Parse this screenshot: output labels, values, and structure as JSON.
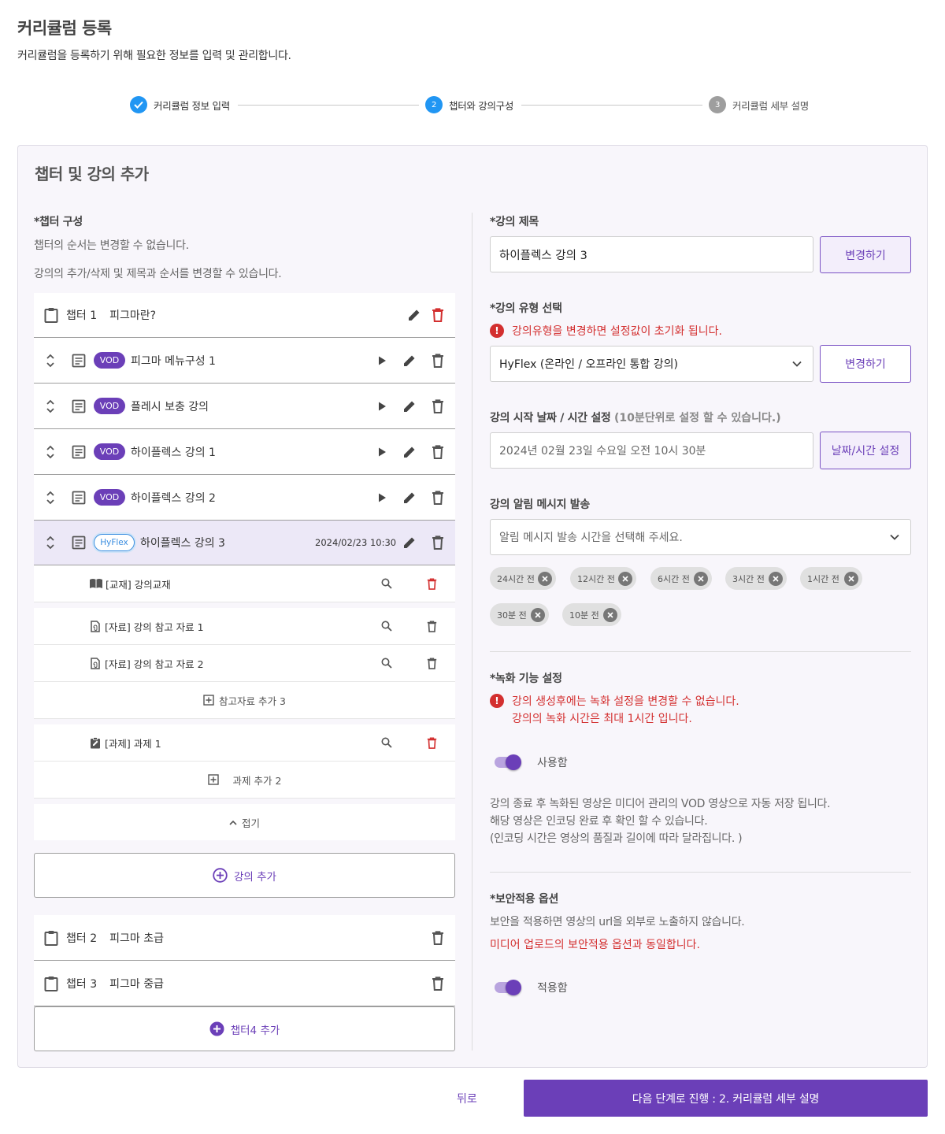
{
  "header": {
    "title": "커리큘럼 등록",
    "subtitle": "커리큘럼을 등록하기 위해 필요한 정보를 입력 및 관리합니다."
  },
  "stepper": {
    "steps": [
      {
        "number": "",
        "label": "커리큘럼 정보 입력",
        "state": "completed",
        "icon": "check-icon"
      },
      {
        "number": "2",
        "label": "챕터와 강의구성",
        "state": "active"
      },
      {
        "number": "3",
        "label": "커리큘럼 세부 설명",
        "state": "pending"
      }
    ]
  },
  "panel": {
    "title": "챕터 및 강의 추가"
  },
  "left": {
    "chapter_label": "*챕터 구성",
    "note1": "챕터의 순서는 변경할 수 없습니다.",
    "note2": "강의의 추가/삭제 및 제목과 순서를 변경할 수 있습니다.",
    "chapter1": {
      "number": "챕터 1",
      "title": "피그마란?"
    },
    "lectures": [
      {
        "badge": "VOD",
        "title": "피그마 메뉴구성 1"
      },
      {
        "badge": "VOD",
        "title": "플레시 보충 강의"
      },
      {
        "badge": "VOD",
        "title": "하이플렉스 강의 1"
      },
      {
        "badge": "VOD",
        "title": "하이플렉스 강의 2"
      }
    ],
    "active_lecture": {
      "badge": "HyFlex",
      "title": "하이플렉스 강의 3",
      "datetime": "2024/02/23 10:30"
    },
    "materials": [
      {
        "label": "[교재] 강의교재",
        "icon": "book-icon",
        "delete_color": "#d32f2f"
      },
      {
        "label": "[자료] 강의 참고 자료 1",
        "icon": "file-icon",
        "delete_color": "#555555"
      },
      {
        "label": "[자료] 강의 참고 자료 2",
        "icon": "file-icon",
        "delete_color": "#555555"
      }
    ],
    "add_reference": "참고자료 추가 3",
    "assignment": {
      "label": "[과제] 과제 1",
      "icon": "assignment-icon"
    },
    "add_assignment": "과제 추가 2",
    "collapse": "접기",
    "add_lecture": "강의 추가",
    "chapter2": {
      "number": "챕터 2",
      "title": "피그마 초급"
    },
    "chapter3": {
      "number": "챕터 3",
      "title": "피그마 중급"
    },
    "add_chapter": "챕터4 추가"
  },
  "right": {
    "title_label": "*강의 제목",
    "title_value": "하이플렉스 강의 3",
    "change_btn": "변경하기",
    "type_label": "*강의 유형 선택",
    "type_warning": "강의유형을 변경하면 설정값이 초기화 됩니다.",
    "type_value": "HyFlex (온라인 / 오프라인 통합 강의)",
    "type_change_btn": "변경하기",
    "date_label": "강의 시작 날짜 / 시간 설정",
    "date_hint": "(10분단위로 설정 할 수 있습니다.)",
    "date_value": "2024년  02월 23일 수요일  오전 10시 30분",
    "date_btn": "날짜/시간 설정",
    "alert_label": "강의 알림 메시지 발송",
    "alert_placeholder": "알림 메시지 발송 시간을 선택해 주세요.",
    "chips": [
      "24시간 전",
      "12시간 전",
      "6시간 전",
      "3시간 전",
      "1시간 전",
      "30분 전",
      "10분 전"
    ],
    "record_label": "*녹화 기능 설정",
    "record_warning1": "강의 생성후에는 녹화 설정을 변경할 수 없습니다.",
    "record_warning2": "강의의 녹화 시간은 최대 1시간 입니다.",
    "record_toggle": "사용함",
    "record_desc1": "강의 종료 후 녹화된 영상은 미디어 관리의 VOD 영상으로 자동 저장 됩니다.",
    "record_desc2": "해당 영상은 인코딩 완료 후 확인 할 수 있습니다.",
    "record_desc3": "(인코딩 시간은 영상의 품질과 길이에 따라 달라집니다. )",
    "security_label": "*보안적용 옵션",
    "security_desc": "보안을 적용하면 영상의 url을 외부로 노출하지 않습니다.",
    "security_warning": "미디어 업로드의 보안적용 옵션과 동일합니다.",
    "security_toggle": "적용함"
  },
  "footer": {
    "back": "뒤로",
    "next": "다음 단계로 진행 : 2. 커리큘럼 세부 설명"
  },
  "colors": {
    "primary": "#6b3fb8",
    "step_blue": "#2196f3",
    "hyflex_blue": "#3a8de0",
    "danger": "#d32f2f",
    "active_row": "#ece8f7"
  }
}
